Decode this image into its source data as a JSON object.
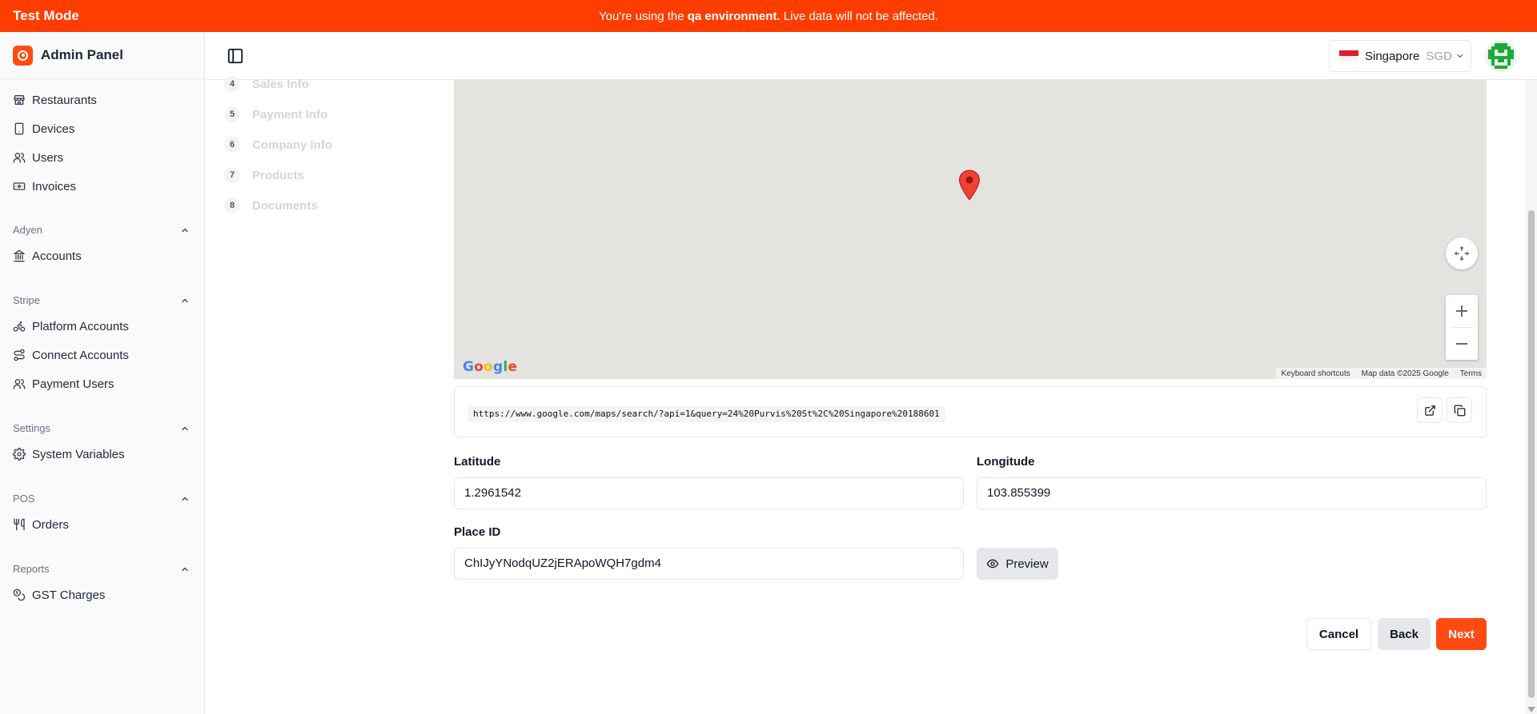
{
  "banner": {
    "mode": "Test Mode",
    "message_pre": "You're using the",
    "message_env": "qa environment.",
    "message_post": "Live data will not be affected."
  },
  "sidebar": {
    "brand": "Admin Panel",
    "top_items": [
      {
        "label": "Restaurants",
        "icon": "store-icon"
      },
      {
        "label": "Devices",
        "icon": "tablet-icon"
      },
      {
        "label": "Users",
        "icon": "users-icon"
      },
      {
        "label": "Invoices",
        "icon": "banknote-icon"
      }
    ],
    "groups": [
      {
        "title": "Adyen",
        "items": [
          {
            "label": "Accounts",
            "icon": "landmark-icon"
          }
        ]
      },
      {
        "title": "Stripe",
        "items": [
          {
            "label": "Platform Accounts",
            "icon": "bike-icon"
          },
          {
            "label": "Connect Accounts",
            "icon": "route-icon"
          },
          {
            "label": "Payment Users",
            "icon": "users-icon"
          }
        ]
      },
      {
        "title": "Settings",
        "items": [
          {
            "label": "System Variables",
            "icon": "gear-icon"
          }
        ]
      },
      {
        "title": "POS",
        "items": [
          {
            "label": "Orders",
            "icon": "utensils-icon"
          }
        ]
      },
      {
        "title": "Reports",
        "items": [
          {
            "label": "GST Charges",
            "icon": "coins-icon"
          }
        ]
      }
    ]
  },
  "header": {
    "country": "Singapore",
    "currency": "SGD"
  },
  "steps": [
    {
      "num": "4",
      "label": "Sales Info"
    },
    {
      "num": "5",
      "label": "Payment Info"
    },
    {
      "num": "6",
      "label": "Company Info"
    },
    {
      "num": "7",
      "label": "Products"
    },
    {
      "num": "8",
      "label": "Documents"
    }
  ],
  "map": {
    "logo": "Google",
    "footer": [
      "Keyboard shortcuts",
      "Map data ©2025 Google",
      "Terms"
    ]
  },
  "url": "https://www.google.com/maps/search/?api=1&query=24%20Purvis%20St%2C%20Singapore%20188601",
  "form": {
    "latitude_label": "Latitude",
    "latitude_value": "1.2961542",
    "longitude_label": "Longitude",
    "longitude_value": "103.855399",
    "place_id_label": "Place ID",
    "place_id_value": "ChIJyYNodqUZ2jERApoWQH7gdm4",
    "preview_label": "Preview"
  },
  "actions": {
    "cancel": "Cancel",
    "back": "Back",
    "next": "Next"
  },
  "colors": {
    "accent": "#ff4b12",
    "banner": "#ff3d00"
  }
}
